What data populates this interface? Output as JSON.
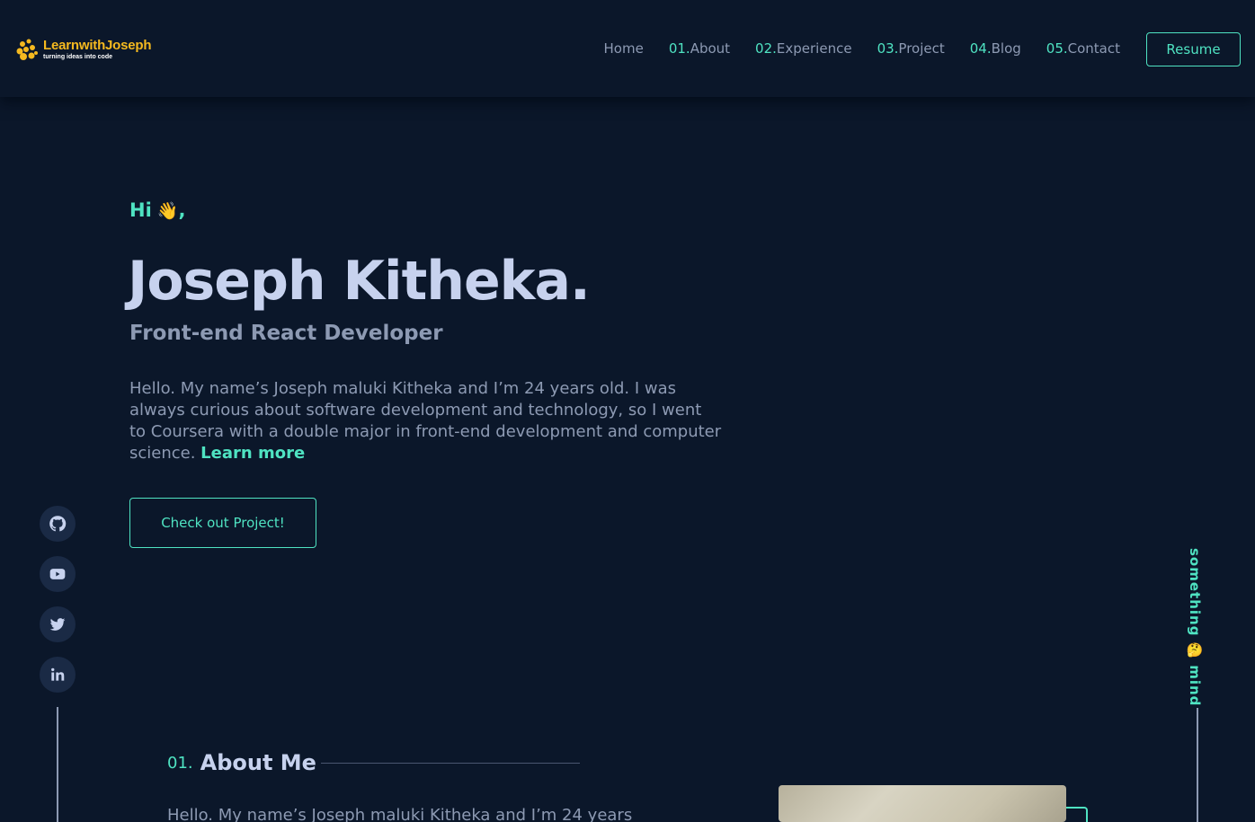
{
  "brand": {
    "title": "LearnwithJoseph",
    "tagline": "turning ideas into code",
    "colors": {
      "accent": "#4fe3c2",
      "logo": "#f5b91f",
      "background": "#0b172a"
    }
  },
  "nav": {
    "items": [
      {
        "num": "",
        "label": "Home"
      },
      {
        "num": "01.",
        "label": "About"
      },
      {
        "num": "02.",
        "label": "Experience"
      },
      {
        "num": "03.",
        "label": "Project"
      },
      {
        "num": "04.",
        "label": "Blog"
      },
      {
        "num": "05.",
        "label": "Contact"
      }
    ],
    "resume_label": "Resume"
  },
  "hero": {
    "greeting": "Hi",
    "greeting_emoji": "👋",
    "greeting_punct": ",",
    "name": "Joseph Kitheka.",
    "role": "Front-end React Developer",
    "bio": "Hello. My name’s Joseph maluki Kitheka and I’m 24 years old. I was always curious about software development and technology, so I went to Coursera with a double major in front-end development and computer science. ",
    "learn_more": "Learn more",
    "cta_label": "Check out Project!"
  },
  "social": {
    "icons": [
      "github-icon",
      "youtube-icon",
      "twitter-icon",
      "linkedin-icon"
    ]
  },
  "side": {
    "text": "something 🤔 mind"
  },
  "about": {
    "num": "01.",
    "title": "About Me",
    "text": "Hello. My name’s Joseph maluki Kitheka and I’m 24 years"
  }
}
